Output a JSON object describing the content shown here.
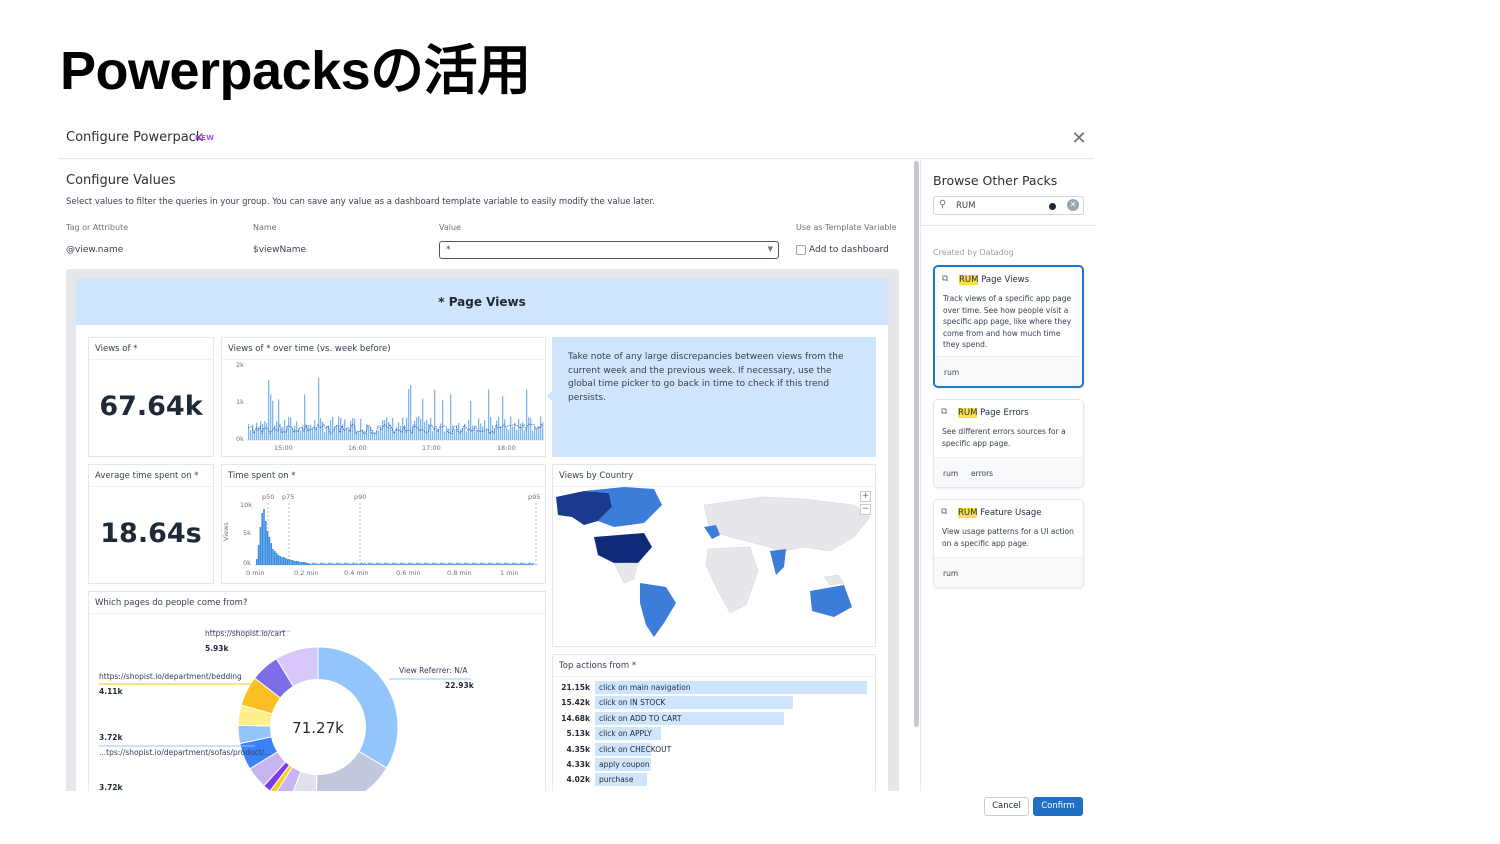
{
  "slide_title": "Powerpacksの活用",
  "modal": {
    "title": "Configure Powerpack",
    "badge": "NEW",
    "close_icon": "close-icon",
    "configure": {
      "title": "Configure Values",
      "description": "Select values to filter the queries in your group. You can save any value as a dashboard template variable to easily modify the value later.",
      "headers": [
        "Tag or Attribute",
        "Name",
        "Value",
        "Use as Template Variable"
      ],
      "row": {
        "tag": "@view.name",
        "name": "$viewName",
        "value": "*",
        "checkbox_label": "Add to dashboard"
      }
    },
    "preview": {
      "header": "* Page Views",
      "views_widget": {
        "title": "Views of *",
        "value": "67.64k"
      },
      "timeseries_widget": {
        "title": "Views of * over time (vs. week before)",
        "y_ticks": [
          "2k",
          "1k",
          "0k"
        ],
        "x_ticks": [
          "15:00",
          "16:00",
          "17:00",
          "18:00"
        ]
      },
      "note": "Take note of any large discrepancies between views from the current week and the previous week. If necessary, use the global time picker to go back in time to check if this trend persists.",
      "avg_widget": {
        "title": "Average time spent on *",
        "value": "18.64s"
      },
      "dist_widget": {
        "title": "Time spent on *",
        "y_label": "Views",
        "y_ticks": [
          "10k",
          "5k",
          "0k"
        ],
        "x_ticks": [
          "0 min",
          "0.2 min",
          "0.4 min",
          "0.6 min",
          "0.8 min",
          "1 min"
        ],
        "markers": [
          "p50",
          "p75",
          "p90",
          "p95"
        ]
      },
      "map_widget": {
        "title": "Views by Country",
        "zoom_in": "+",
        "zoom_out": "−"
      },
      "pie_widget": {
        "title": "Which pages do people come from?",
        "center": "71.27k",
        "labels": [
          {
            "name": "https://shopist.io/cart",
            "value": "5.93k"
          },
          {
            "name": "https://shopist.io/department/bedding",
            "value": "4.11k"
          },
          {
            "name": "View Referrer: N/A",
            "value": "22.93k"
          },
          {
            "name": "...tps://shopist.io/department/sofas/product/...",
            "value": "3.72k"
          },
          {
            "name": "",
            "value": "3.72k"
          }
        ]
      },
      "top_actions": {
        "title": "Top actions from *",
        "rows": [
          {
            "value": "21.15k",
            "label": "click on main navigation",
            "frac": 1.0
          },
          {
            "value": "15.42k",
            "label": "click on IN STOCK",
            "frac": 0.729
          },
          {
            "value": "14.68k",
            "label": "click on ADD TO CART",
            "frac": 0.694
          },
          {
            "value": "5.13k",
            "label": "click on APPLY",
            "frac": 0.243
          },
          {
            "value": "4.35k",
            "label": "click on CHECKOUT",
            "frac": 0.206
          },
          {
            "value": "4.33k",
            "label": "apply coupon",
            "frac": 0.205
          },
          {
            "value": "4.02k",
            "label": "purchase",
            "frac": 0.19
          }
        ]
      }
    },
    "browse": {
      "title": "Browse Other Packs",
      "search_value": "RUM",
      "group_label": "Created by Datadog",
      "packs": [
        {
          "highlight": "RUM",
          "name": " Page Views",
          "description": "Track views of a specific app page over time. See how people visit a specific app page, like where they come from and how much time they spend.",
          "tags": [
            "rum"
          ]
        },
        {
          "highlight": "RUM",
          "name": " Page Errors",
          "description": "See different errors sources for a specific app page.",
          "tags": [
            "rum",
            "errors"
          ]
        },
        {
          "highlight": "RUM",
          "name": " Feature Usage",
          "description": "View usage patterns for a UI action on a specific app page.",
          "tags": [
            "rum"
          ]
        }
      ]
    },
    "buttons": {
      "cancel": "Cancel",
      "confirm": "Confirm"
    }
  },
  "colors": {
    "accent": "#1f6fc7",
    "light_blue": "#cfe5fc",
    "highlight": "#fde047"
  }
}
